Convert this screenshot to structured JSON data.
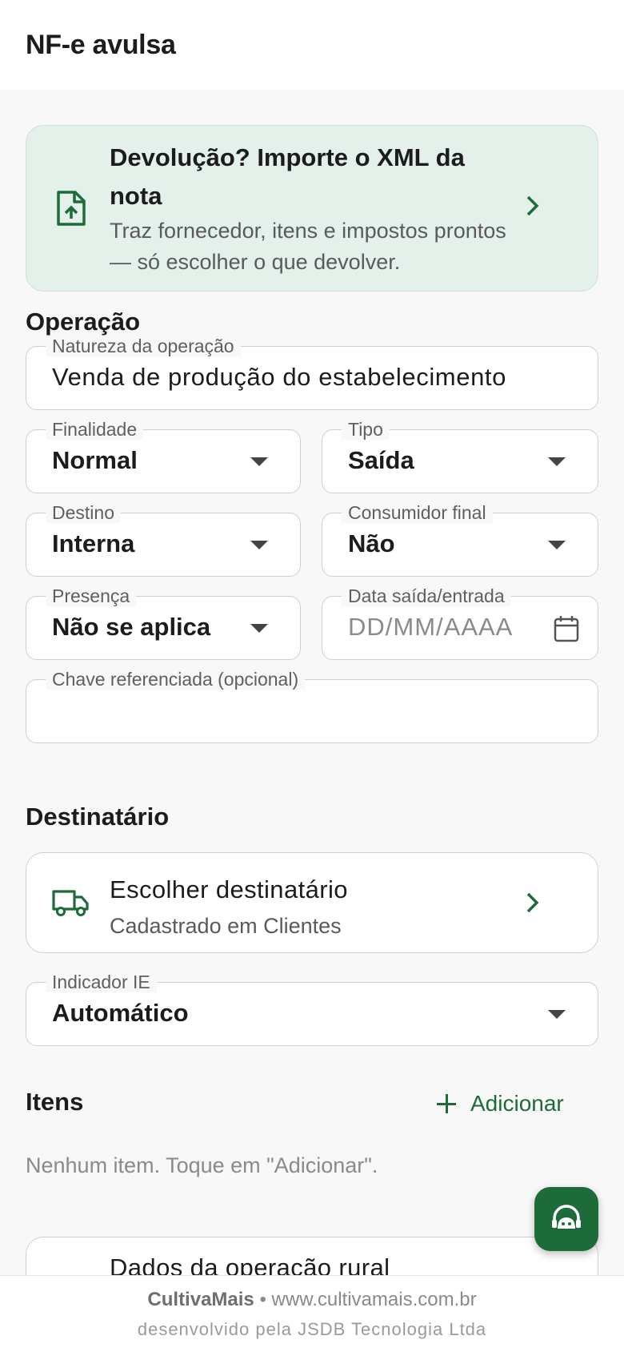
{
  "header": {
    "title": "NF-e avulsa"
  },
  "import_card": {
    "title": "Devolução? Importe o XML da nota",
    "subtitle": "Traz fornecedor, itens e impostos prontos — só escolher o que devolver.",
    "icon": "file-upload-icon"
  },
  "operacao": {
    "section_title": "Operação",
    "natureza": {
      "label": "Natureza da operação",
      "value": "Venda de produção do estabelecimento"
    },
    "finalidade": {
      "label": "Finalidade",
      "value": "Normal"
    },
    "tipo": {
      "label": "Tipo",
      "value": "Saída"
    },
    "destino": {
      "label": "Destino",
      "value": "Interna"
    },
    "consumidor_final": {
      "label": "Consumidor final",
      "value": "Não"
    },
    "presenca": {
      "label": "Presença",
      "value": "Não se aplica"
    },
    "data_saida": {
      "label": "Data saída/entrada",
      "placeholder": "DD/MM/AAAA"
    },
    "chave": {
      "label": "Chave referenciada (opcional)",
      "value": ""
    }
  },
  "destinatario": {
    "section_title": "Destinatário",
    "card_title": "Escolher destinatário",
    "card_subtitle": "Cadastrado em Clientes",
    "icon": "truck-icon",
    "indicador_ie": {
      "label": "Indicador IE",
      "value": "Automático"
    }
  },
  "itens": {
    "section_title": "Itens",
    "add_label": "Adicionar",
    "empty_text": "Nenhum item. Toque em \"Adicionar\"."
  },
  "rural": {
    "title": "Dados da operação rural"
  },
  "fab": {
    "icon": "support-agent-icon"
  },
  "footer": {
    "brand": "CultivaMais",
    "separator": "•",
    "url": "www.cultivamais.com.br",
    "credit": "desenvolvido pela JSDB Tecnologia Ltda"
  },
  "colors": {
    "primary": "#1e6b3a",
    "accent_bg": "#e3f1ea",
    "background": "#f8f8f8"
  }
}
